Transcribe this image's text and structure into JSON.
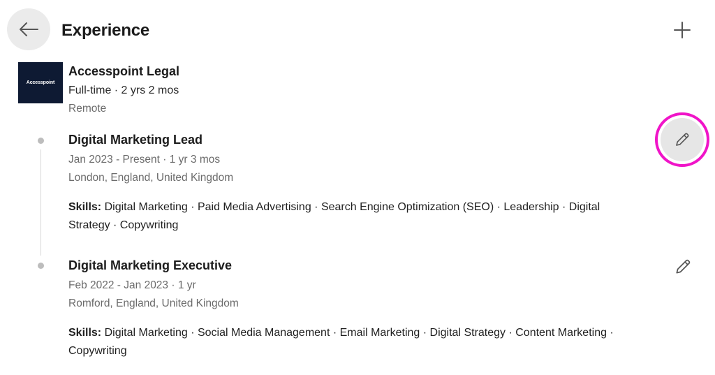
{
  "header": {
    "title": "Experience",
    "back_icon": "arrow-left-icon",
    "add_icon": "plus-icon"
  },
  "company": {
    "logo_text": "Accesspoint",
    "name": "Accesspoint Legal",
    "meta": "Full-time · 2 yrs 2 mos",
    "location": "Remote"
  },
  "roles": [
    {
      "title": "Digital Marketing Lead",
      "dates": "Jan 2023 - Present · 1 yr 3 mos",
      "location": "London, England, United Kingdom",
      "skills_label": "Skills:",
      "skills_line1": " Digital Marketing · Paid Media Advertising · Search Engine Optimization (SEO) · Leadership · Digital",
      "skills_line2": "Strategy · Copywriting",
      "edit_icon": "pencil-icon"
    },
    {
      "title": "Digital Marketing Executive",
      "dates": "Feb 2022 - Jan 2023 · 1 yr",
      "location": "Romford, England, United Kingdom",
      "skills_label": "Skills:",
      "skills_line1": " Digital Marketing · Social Media Management · Email Marketing · Digital Strategy · Content Marketing ·",
      "skills_line2": "Copywriting",
      "edit_icon": "pencil-icon"
    }
  ],
  "colors": {
    "highlight_ring": "#f014c8",
    "logo_bg": "#0e1a33",
    "muted_text": "#6b6b6b"
  }
}
